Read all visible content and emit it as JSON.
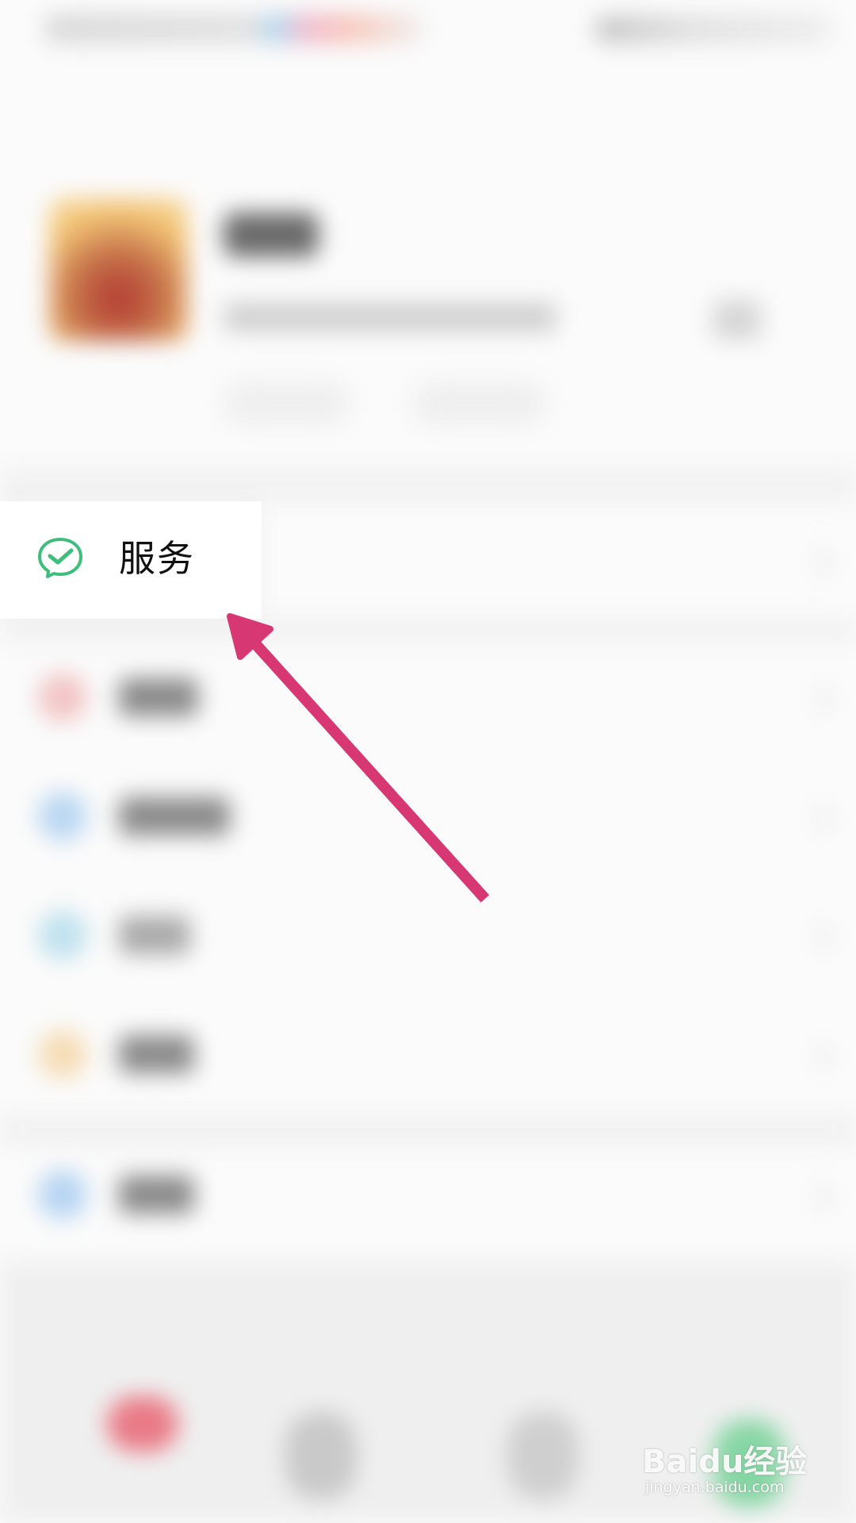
{
  "service_item": {
    "label": "服务",
    "icon": "wechat-pay-check-icon",
    "icon_color": "#3fbd7a"
  },
  "annotation": {
    "arrow_color": "#d73772"
  },
  "watermark": {
    "brand": "Baidu经验",
    "url": "jingyan.baidu.com"
  }
}
